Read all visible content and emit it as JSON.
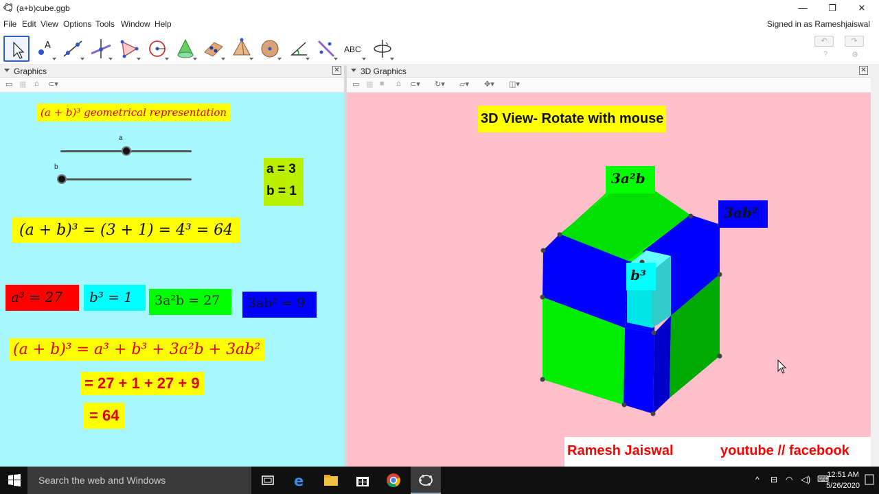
{
  "window": {
    "title": "(a+b)cube.ggb",
    "minimize": "—",
    "maximize": "❐",
    "close": "✕"
  },
  "menu": [
    "File",
    "Edit",
    "View",
    "Options",
    "Tools",
    "Window",
    "Help"
  ],
  "signed_in": "Signed in as Rameshjaiswal",
  "toolbar": {
    "text_tool_label": "ABC",
    "undo": "↶",
    "redo": "↷",
    "help": "?",
    "settings": "⚙"
  },
  "graphics_panel": {
    "title": "Graphics",
    "heading": "(a + b)³ geometrical representation",
    "slider_a": {
      "label": "a",
      "value_fraction": 0.49
    },
    "slider_b": {
      "label": "b",
      "value_fraction": 0.0
    },
    "values": {
      "a": "a = 3",
      "b": "b = 1"
    },
    "formula1": "(a + b)³ = (3 + 1) = 4³ = 64",
    "terms": {
      "a3": "a³ = 27",
      "b3": "b³ = 1",
      "a2b": "3a²b = 27",
      "ab2": "3ab² = 9"
    },
    "expansion1": "(a + b)³ = a³ + b³ + 3a²b + 3ab²",
    "expansion2": "= 27 + 1 + 27 + 9",
    "expansion3": "= 64"
  },
  "view3d_panel": {
    "title": "3D Graphics",
    "caption": "3D View- Rotate with mouse",
    "labels": {
      "a2b": "3a²b",
      "ab2": "3ab²",
      "b3": "b³"
    },
    "credit_name": "Ramesh Jaiswal",
    "credit_links": "youtube // facebook"
  },
  "colors": {
    "graphics_bg": "#a6f7ff",
    "view3d_bg": "#ffc0cb",
    "red": "#ff0000",
    "cyan": "#00ffff",
    "green": "#00ff00",
    "blue": "#0000ff",
    "yellow": "#ffff00"
  },
  "taskbar": {
    "search_placeholder": "Search the web and Windows",
    "time": "12:51 AM",
    "date": "5/26/2020"
  }
}
